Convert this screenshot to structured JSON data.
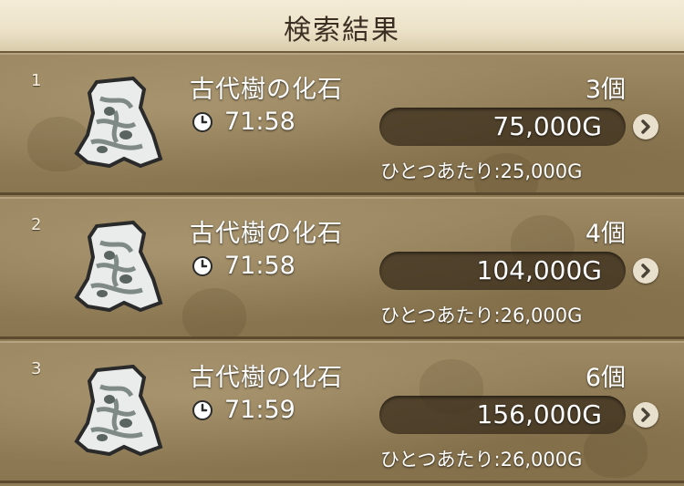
{
  "header": {
    "title": "検索結果"
  },
  "rows": [
    {
      "rank": "1",
      "name": "古代樹の化石",
      "time": "71:58",
      "quantity": "3個",
      "price": "75,000G",
      "unit_price": "ひとつあたり:25,000G"
    },
    {
      "rank": "2",
      "name": "古代樹の化石",
      "time": "71:58",
      "quantity": "4個",
      "price": "104,000G",
      "unit_price": "ひとつあたり:26,000G"
    },
    {
      "rank": "3",
      "name": "古代樹の化石",
      "time": "71:59",
      "quantity": "6個",
      "price": "156,000G",
      "unit_price": "ひとつあたり:26,000G"
    }
  ],
  "icons": {
    "item": "fossil-icon",
    "time": "clock-icon",
    "detail": "chevron-right-icon"
  },
  "colors": {
    "background": "#8e7a55",
    "header": "#ece2c8",
    "pill": "#3c301e"
  }
}
